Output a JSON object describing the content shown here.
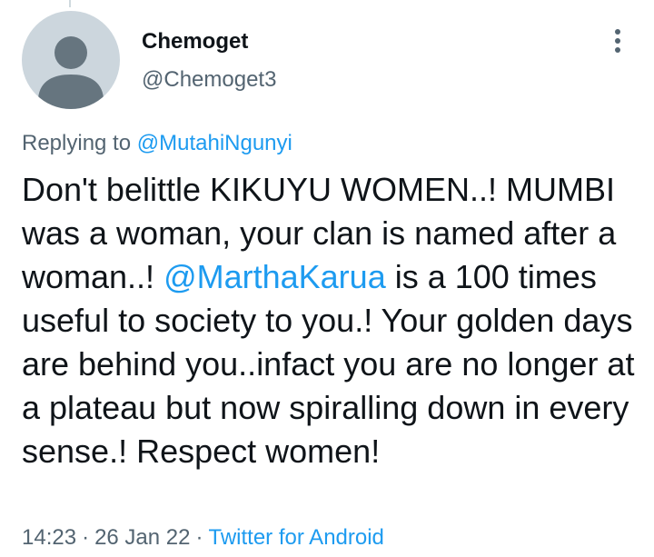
{
  "tweet": {
    "author_name": "Chemoget",
    "author_handle": "@Chemoget3",
    "avatar_icon": "default-profile-silhouette-icon",
    "more_icon": "more-vertical-icon",
    "replying_prefix": "Replying to",
    "replying_to": "@MutahiNgunyi",
    "text_part1": "Don't belittle KIKUYU WOMEN..! MUMBI was a woman, your clan is named after a woman..! ",
    "mention": "@MarthaKarua",
    "text_part2": " is a 100 times useful to society to you.! Your golden days are behind you..infact you are no longer at a plateau but now spiralling down in every sense.! Respect women!",
    "time": "14:23",
    "date": "26 Jan 22",
    "separator": "·",
    "source": "Twitter for Android"
  },
  "colors": {
    "text": "#0f1419",
    "secondary": "#536471",
    "link": "#1d9bf0",
    "avatar_bg": "#ccd6dd",
    "avatar_fg": "#66757f"
  }
}
